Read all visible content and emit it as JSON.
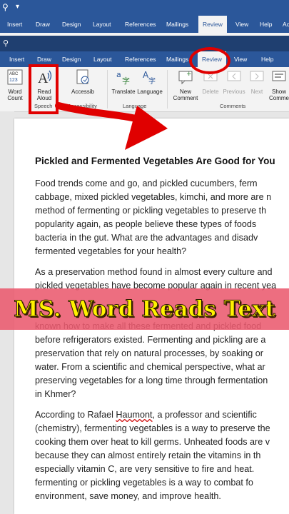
{
  "tabs_top": [
    "Insert",
    "Draw",
    "Design",
    "Layout",
    "References",
    "Mailings",
    "Review",
    "View",
    "Help",
    "Ac"
  ],
  "tabs_second": [
    "Insert",
    "Draw",
    "Design",
    "Layout",
    "References",
    "Mailings",
    "Review",
    "View",
    "Help"
  ],
  "ribbon": {
    "word_count": [
      "Word",
      "Count"
    ],
    "read_aloud": [
      "Read",
      "Aloud"
    ],
    "accessibility": "Accessib",
    "translate": "Translate",
    "language": "Language",
    "new_comment": [
      "New",
      "Comment"
    ],
    "delete": "Delete",
    "previous": "Previous",
    "next": "Next",
    "show_comments": [
      "Show",
      "Comme"
    ],
    "groups": {
      "speech": "Speech",
      "accessibility": "Accessibility",
      "language": "Language",
      "comments": "Comments"
    }
  },
  "banner": "MS. Word Reads Text",
  "document": {
    "title": "Pickled and Fermented Vegetables Are Good for You",
    "p1": [
      "Food trends come and go, and pickled cucumbers, ferm",
      "cabbage, mixed pickled vegetables, kimchi, and more are n",
      "method of fermenting or pickling vegetables to preserve th",
      "popularity again, as people believe these types of foods",
      "bacteria in the gut. What are the advantages and disadv",
      "fermented vegetables for your health?"
    ],
    "p2": [
      "As a preservation method found in almost every culture and",
      "pickled vegetables have become popular again in recent yea",
      "known how to make all these fermented and pickled food",
      "before refrigerators existed. Fermenting and pickling are a",
      "preservation that rely on natural processes, by soaking or",
      "water. From a scientific and chemical perspective, what ar",
      "preserving vegetables for a long time through fermentation",
      "in Khmer?"
    ],
    "p3_prefix": "According to Rafael ",
    "p3_name": "Haumont",
    "p3_suffix": ", a professor and scientific",
    "p3": [
      "(chemistry), fermenting vegetables is a way to preserve the",
      "cooking them over heat to kill germs. Unheated foods are v",
      "because they can almost entirely retain the vitamins in th",
      "especially vitamin C, are very sensitive to fire and heat.",
      "fermenting or pickling vegetables is a way to combat fo",
      "environment, save money, and improve health."
    ]
  },
  "colors": {
    "word_blue": "#2b579a",
    "highlight_red": "#e00000",
    "banner_pink": "#eb5a6e",
    "banner_text": "#fff200"
  }
}
